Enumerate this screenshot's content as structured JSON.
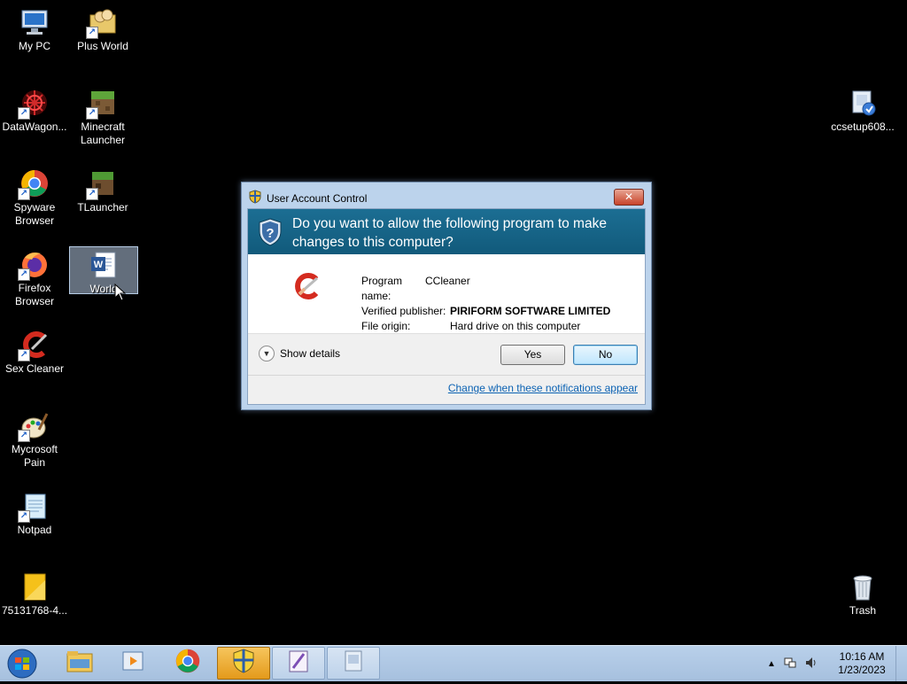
{
  "desktop": {
    "icons": [
      {
        "label": "My PC",
        "icon": "computer-icon"
      },
      {
        "label": "Plus World",
        "icon": "users-folder-icon"
      },
      {
        "label": "DataWagon...",
        "icon": "datawagon-icon"
      },
      {
        "label": "Minecraft Launcher",
        "icon": "minecraft-icon"
      },
      {
        "label": "Spyware Browser",
        "icon": "chrome-icon"
      },
      {
        "label": "TLauncher",
        "icon": "tlauncher-icon"
      },
      {
        "label": "Firefox Browser",
        "icon": "firefox-icon"
      },
      {
        "label": "World",
        "icon": "word-doc-icon",
        "selected": true
      },
      {
        "label": "Sex Cleaner",
        "icon": "ccleaner-icon"
      },
      {
        "label": "Mycrosoft Pain",
        "icon": "paint-icon"
      },
      {
        "label": "Notpad",
        "icon": "notepad-icon"
      },
      {
        "label": "75131768-4...",
        "icon": "image-file-icon"
      },
      {
        "label": "ccsetup608...",
        "icon": "installer-icon"
      },
      {
        "label": "Trash",
        "icon": "recycle-bin-icon"
      }
    ]
  },
  "dialog": {
    "title": "User Account Control",
    "question": "Do you want to allow the following program to make changes to this computer?",
    "program_name_key": "Program name:",
    "program_name_value": "CCleaner",
    "publisher_key": "Verified publisher:",
    "publisher_value": "PIRIFORM SOFTWARE LIMITED",
    "origin_key": "File origin:",
    "origin_value": "Hard drive on this computer",
    "show_details": "Show details",
    "yes_label": "Yes",
    "no_label": "No",
    "link": "Change when these notifications appear",
    "close_glyph": "✕"
  },
  "taskbar": {
    "items": [
      {
        "icon": "explorer-folder-icon",
        "state": "pinned"
      },
      {
        "icon": "media-player-icon",
        "state": "pinned"
      },
      {
        "icon": "chrome-icon",
        "state": "pinned"
      },
      {
        "icon": "uac-shield-icon",
        "state": "active"
      },
      {
        "icon": "paint-app-icon",
        "state": "open"
      },
      {
        "icon": "installer-app-icon",
        "state": "open"
      }
    ],
    "time": "10:16 AM",
    "date": "1/23/2023"
  },
  "colors": {
    "desktop_bg": "#000000",
    "uac_header": "#15648a",
    "taskbar": "#b0c8e4",
    "active_task": "#f0b43b",
    "link": "#0b62b3"
  }
}
